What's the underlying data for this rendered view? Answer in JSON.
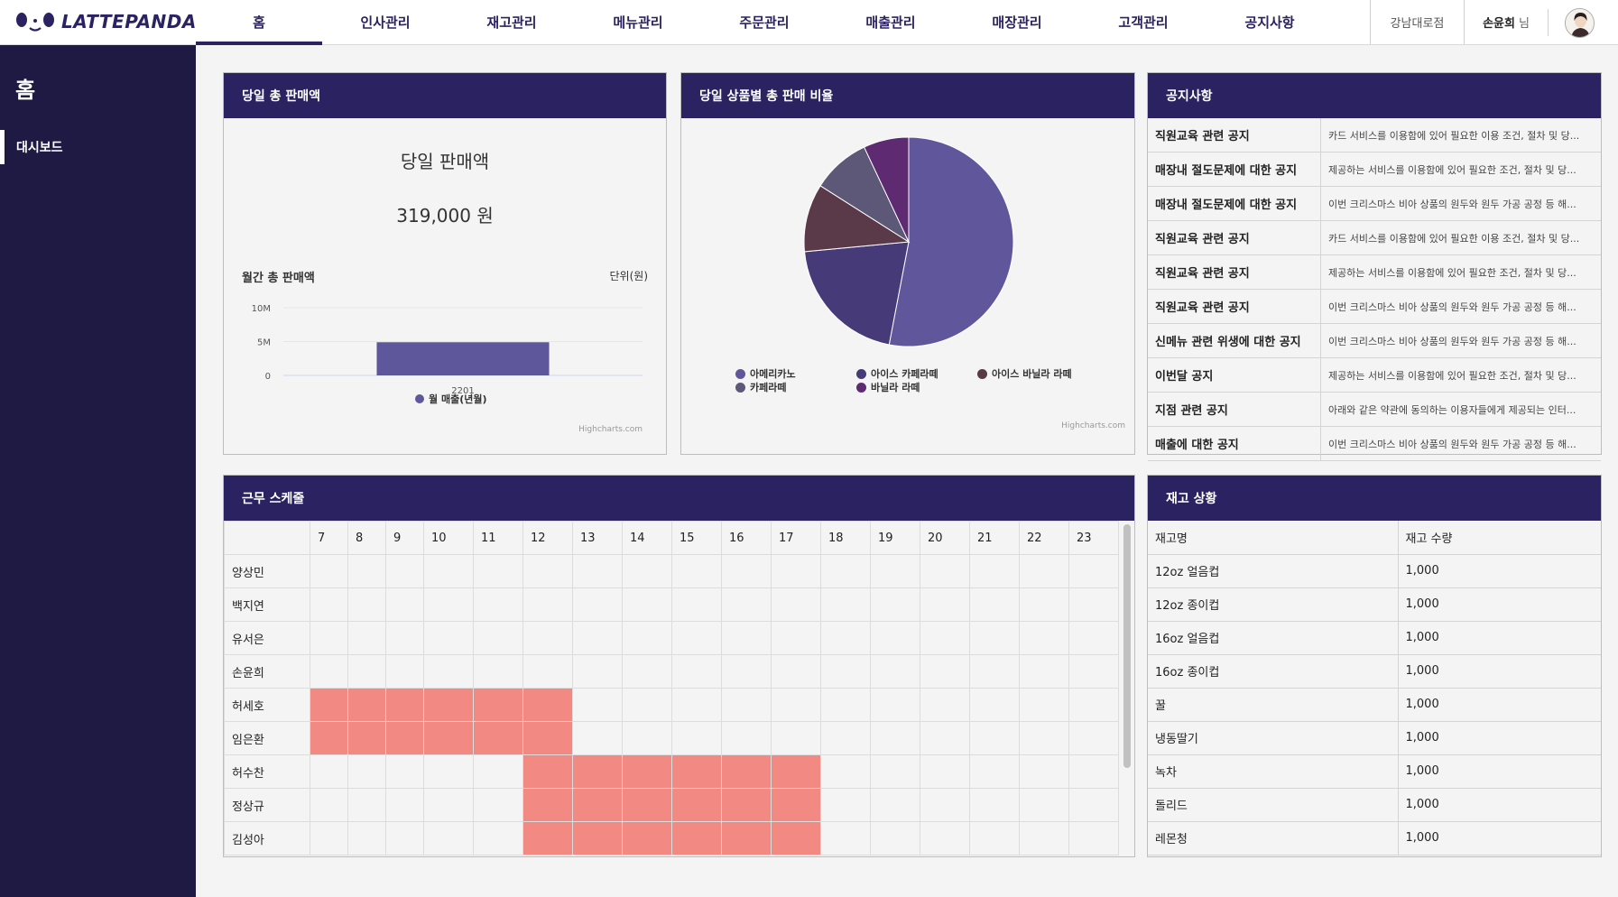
{
  "brand": {
    "name": "LATTEPANDA"
  },
  "nav": {
    "tabs": [
      "홈",
      "인사관리",
      "재고관리",
      "메뉴관리",
      "주문관리",
      "매출관리",
      "매장관리",
      "고객관리",
      "공지사항"
    ],
    "active": "홈"
  },
  "header": {
    "store": "강남대로점",
    "user_name": "손윤희",
    "user_suffix": "님"
  },
  "sidebar": {
    "title": "홈",
    "items": [
      {
        "label": "대시보드",
        "active": true
      }
    ]
  },
  "daily_sales": {
    "title": "당일 총 판매액",
    "label": "당일 판매액",
    "value": "319,000 원",
    "monthly_title": "월간 총 판매액",
    "unit": "단위(원)",
    "credit": "Highcharts.com"
  },
  "chart_data": [
    {
      "type": "bar",
      "title": "월간 총 판매액",
      "categories": [
        "2201"
      ],
      "series": [
        {
          "name": "월 매출(년월)",
          "values": [
            4900000
          ],
          "color": "#5f579b"
        }
      ],
      "ylim": [
        0,
        10000000
      ],
      "yticks": [
        "0",
        "5M",
        "10M"
      ],
      "legend": "bottom-center",
      "grid": true
    },
    {
      "type": "pie",
      "title": "당일 상품별 총 판매 비율",
      "slices": [
        {
          "name": "아메리카노",
          "value": 53,
          "color": "#5f569c"
        },
        {
          "name": "아이스 카페라떼",
          "value": 20.5,
          "color": "#463a78"
        },
        {
          "name": "아이스 바닐라 라떼",
          "value": 10.5,
          "color": "#5a3a48"
        },
        {
          "name": "카페라떼",
          "value": 9,
          "color": "#5d5878"
        },
        {
          "name": "바닐라 라떼",
          "value": 7,
          "color": "#5e2a72"
        }
      ],
      "legend": "bottom"
    }
  ],
  "pie": {
    "title": "당일 상품별 총 판매 비율",
    "credit": "Highcharts.com"
  },
  "notices": {
    "title": "공지사항",
    "items": [
      {
        "title": "직원교육 관련 공지",
        "desc": "카드 서비스를 이용함에 있어 필요한 이용 조건, 절차 및 당..."
      },
      {
        "title": "매장내 절도문제에 대한 공지",
        "desc": "제공하는 서비스를 이용함에 있어 필요한 조건, 절차 및 당..."
      },
      {
        "title": "매장내 절도문제에 대한 공지",
        "desc": "이번 크리스마스 비아 상품의 원두와 원두 가공 공정 등 해..."
      },
      {
        "title": "직원교육 관련 공지",
        "desc": "카드 서비스를 이용함에 있어 필요한 이용 조건, 절차 및 당..."
      },
      {
        "title": "직원교육 관련 공지",
        "desc": "제공하는 서비스를 이용함에 있어 필요한 조건, 절차 및 당..."
      },
      {
        "title": "직원교육 관련 공지",
        "desc": "이번 크리스마스 비아 상품의 원두와 원두 가공 공정 등 해..."
      },
      {
        "title": "신메뉴 관련 위생에 대한 공지",
        "desc": "이번 크리스마스 비아 상품의 원두와 원두 가공 공정 등 해..."
      },
      {
        "title": "이번달 공지",
        "desc": "제공하는 서비스를 이용함에 있어 필요한 조건, 절차 및 당..."
      },
      {
        "title": "지점 관련 공지",
        "desc": "아래와 같은 약관에 동의하는 이용자들에게 제공되는 인터..."
      },
      {
        "title": "매출에 대한 공지",
        "desc": "이번 크리스마스 비아 상품의 원두와 원두 가공 공정 등 해..."
      }
    ]
  },
  "schedule": {
    "title": "근무 스케줄",
    "hours": [
      "7",
      "8",
      "9",
      "10",
      "11",
      "12",
      "13",
      "14",
      "15",
      "16",
      "17",
      "18",
      "19",
      "20",
      "21",
      "22",
      "23"
    ],
    "rows": [
      {
        "name": "양상민",
        "shift": []
      },
      {
        "name": "백지연",
        "shift": []
      },
      {
        "name": "유서은",
        "shift": []
      },
      {
        "name": "손윤희",
        "shift": []
      },
      {
        "name": "허세호",
        "shift": [
          7,
          8,
          9,
          10,
          11,
          12
        ]
      },
      {
        "name": "임은환",
        "shift": [
          7,
          8,
          9,
          10,
          11,
          12
        ]
      },
      {
        "name": "허수찬",
        "shift": [
          12,
          13,
          14,
          15,
          16,
          17
        ]
      },
      {
        "name": "정상규",
        "shift": [
          12,
          13,
          14,
          15,
          16,
          17
        ]
      },
      {
        "name": "김성아",
        "shift": [
          12,
          13,
          14,
          15,
          16,
          17
        ]
      }
    ],
    "shift_color": "#f28982"
  },
  "stock": {
    "title": "재고 상황",
    "columns": [
      "재고명",
      "재고 수량"
    ],
    "rows": [
      [
        "12oz 얼음컵",
        "1,000"
      ],
      [
        "12oz 종이컵",
        "1,000"
      ],
      [
        "16oz 얼음컵",
        "1,000"
      ],
      [
        "16oz 종이컵",
        "1,000"
      ],
      [
        "꿀",
        "1,000"
      ],
      [
        "냉동딸기",
        "1,000"
      ],
      [
        "녹차",
        "1,000"
      ],
      [
        "돌리드",
        "1,000"
      ],
      [
        "레몬청",
        "1,000"
      ]
    ]
  }
}
